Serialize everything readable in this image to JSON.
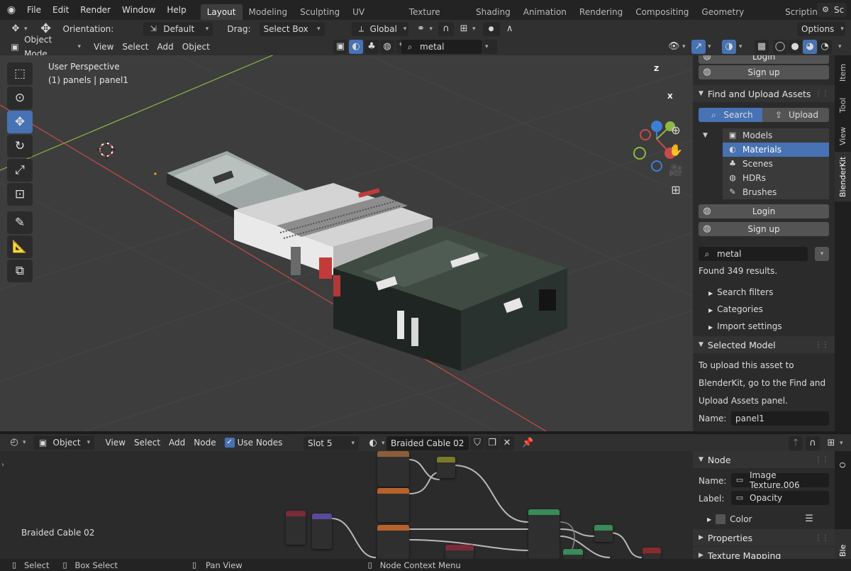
{
  "topbar": {
    "menus": [
      "File",
      "Edit",
      "Render",
      "Window",
      "Help"
    ],
    "workspaces": [
      "Layout",
      "Modeling",
      "Sculpting",
      "UV Editing",
      "Texture Paint",
      "Shading",
      "Animation",
      "Rendering",
      "Compositing",
      "Geometry Nodes",
      "Scripting"
    ],
    "active_workspace": "Layout",
    "add_tab": "+",
    "scene_label": "Sc"
  },
  "tool_header": {
    "orientation_label": "Orientation:",
    "orientation_value": "Default",
    "drag_label": "Drag:",
    "drag_value": "Select Box",
    "transform_orientation": "Global",
    "options_label": "Options"
  },
  "viewport_header": {
    "mode": "Object Mode",
    "menus": [
      "View",
      "Select",
      "Add",
      "Object"
    ],
    "search_value": "metal"
  },
  "viewport": {
    "perspective": "User Perspective",
    "object_info": "(1) panels | panel1",
    "gizmo": {
      "z": "Z",
      "x": "X"
    }
  },
  "npanel": {
    "tabs": [
      "Item",
      "Tool",
      "View",
      "BlenderKit"
    ],
    "active_tab": "BlenderKit",
    "top_login_partial": "Login",
    "top_signup": "Sign up",
    "find_upload_title": "Find and Upload Assets",
    "search_tab": "Search",
    "upload_tab": "Upload",
    "asset_types": [
      "Models",
      "Materials",
      "Scenes",
      "HDRs",
      "Brushes"
    ],
    "selected_asset_type": "Materials",
    "login": "Login",
    "signup": "Sign up",
    "search_value": "metal",
    "results": "Found 349 results.",
    "sections": [
      "Search filters",
      "Categories",
      "Import settings"
    ],
    "selected_model_title": "Selected Model",
    "upload_text": [
      "To upload this asset to",
      "BlenderKit, go to the Find and",
      "Upload Assets panel."
    ],
    "name_label": "Name:",
    "name_value": "panel1"
  },
  "node_header": {
    "object_type": "Object",
    "menus": [
      "View",
      "Select",
      "Add",
      "Node"
    ],
    "use_nodes_label": "Use Nodes",
    "use_nodes_checked": true,
    "slot": "Slot 5",
    "material": "Braided Cable 02"
  },
  "node_editor": {
    "material_label": "Braided Cable 02"
  },
  "node_panel": {
    "title": "Node",
    "name_label": "Name:",
    "name_value": "Image Texture.006",
    "label_label": "Label:",
    "label_value": "Opacity",
    "color_label": "Color",
    "properties_label": "Properties",
    "texture_mapping_label": "Texture Mapping",
    "side_tabs": [
      "O",
      "Ble"
    ]
  },
  "statusbar": {
    "items": [
      "Select",
      "Box Select",
      "Pan View",
      "Node Context Menu"
    ]
  },
  "colors": {
    "accent": "#4772b3",
    "x_axis": "#c9494c",
    "y_axis": "#8cb943",
    "z_axis": "#3d7fd6"
  }
}
